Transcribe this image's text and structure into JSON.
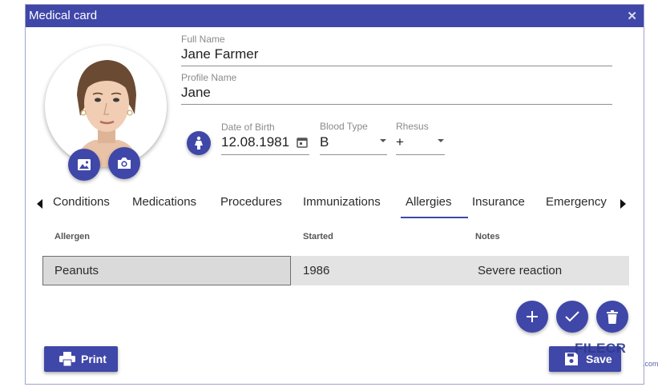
{
  "window": {
    "title": "Medical card",
    "close_glyph": "✕"
  },
  "profile": {
    "full_name_label": "Full Name",
    "full_name": "Jane Farmer",
    "profile_name_label": "Profile Name",
    "profile_name": "Jane",
    "dob_label": "Date of Birth",
    "dob": "12.08.1981",
    "blood_type_label": "Blood Type",
    "blood_type": "B",
    "rhesus_label": "Rhesus",
    "rhesus": "+"
  },
  "tabs": [
    {
      "label": "Conditions"
    },
    {
      "label": "Medications"
    },
    {
      "label": "Procedures"
    },
    {
      "label": "Immunizations"
    },
    {
      "label": "Allergies",
      "active": true
    },
    {
      "label": "Insurance"
    },
    {
      "label": "Emergency"
    }
  ],
  "table": {
    "columns": [
      "Allergen",
      "Started",
      "Notes"
    ],
    "rows": [
      {
        "allergen": "Peanuts",
        "started": "1986",
        "notes": "Severe reaction"
      }
    ]
  },
  "buttons": {
    "print": "Print",
    "save": "Save"
  },
  "watermark": {
    "main": "FILECR",
    "sub": ".com"
  },
  "icons": {
    "image": "image-icon",
    "camera": "camera-icon",
    "gender": "female-icon",
    "calendar": "calendar-icon",
    "add": "plus-icon",
    "confirm": "check-icon",
    "delete": "trash-icon",
    "print": "printer-icon",
    "save": "floppy-icon"
  },
  "colors": {
    "accent": "#3f47a8",
    "row_bg": "#e3e3e3",
    "title_text": "#ffffff"
  }
}
